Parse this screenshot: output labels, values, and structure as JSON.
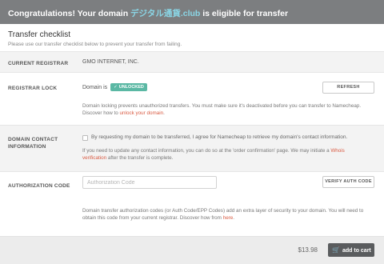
{
  "banner": {
    "prefix": "Congratulations! Your domain ",
    "domain": "デジタル通貨.club",
    "suffix": " is eligible for transfer"
  },
  "checklist": {
    "title": "Transfer checklist",
    "subtitle": "Please use our transfer checklist below to prevent your transfer from failing."
  },
  "current_registrar": {
    "label": "CURRENT REGISTRAR",
    "value": "GMO INTERNET, INC."
  },
  "registrar_lock": {
    "label": "REGISTRAR LOCK",
    "status_prefix": "Domain is",
    "badge": "UNLOCKED",
    "refresh_label": "REFRESH",
    "desc_text": "Domain locking prevents unauthorized transfers. You must make sure it's deactivated before you can transfer to Namecheap. Discover how to ",
    "desc_link": "unlock your domain",
    "desc_end": "."
  },
  "contact_info": {
    "label": "DOMAIN CONTACT INFORMATION",
    "consent": "By requesting my domain to be transferred, I agree for Namecheap to retrieve my domain's contact information.",
    "desc_text": "If you need to update any contact information, you can do so at the 'order confirmation' page. We may initiate a ",
    "desc_link": "Whois verification",
    "desc_end": " after the transfer is complete."
  },
  "auth_code": {
    "label": "AUTHORIZATION CODE",
    "placeholder": "Authorization Code",
    "verify_label": "VERIFY AUTH CODE",
    "desc_text": "Domain transfer authorization codes (or Auth Code/EPP Codes) add an extra layer of security to your domain. You will need to obtain this code from your current registrar. Discover how from ",
    "desc_link": "here",
    "desc_end": "."
  },
  "footer": {
    "price": "$13.98",
    "add_to_cart": "add to cart"
  },
  "colors": {
    "banner_bg": "#7c7e80",
    "domain_accent": "#8ad6e6",
    "badge_bg": "#5bb8a4",
    "link": "#d95b43",
    "cart_button": "#5a5c5e"
  },
  "icons": {
    "badge_check": "check-icon",
    "cart": "cart-icon"
  }
}
